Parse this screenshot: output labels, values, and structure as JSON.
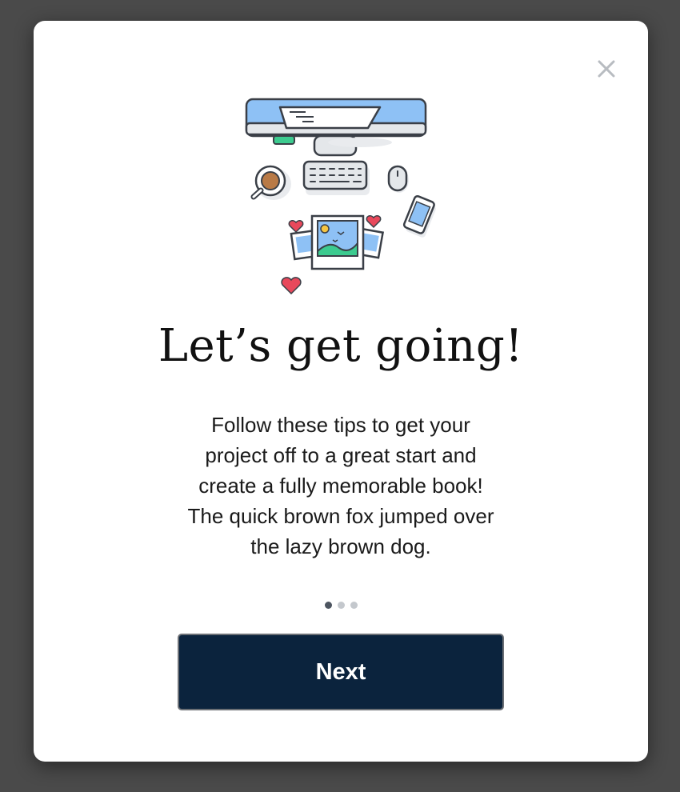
{
  "modal": {
    "title": "Let’s get going!",
    "body": "Follow these tips to get your project off to a great start and create a fully memorable book! The quick brown fox jumped over the lazy brown dog.",
    "next_label": "Next",
    "close_icon": "close-icon",
    "illustration": "desk-workspace-illustration"
  },
  "pagination": {
    "current_step": 1,
    "total_steps": 3
  },
  "colors": {
    "overlay": "#4a4a4a",
    "button_bg": "#0b233d",
    "dot_active": "#4d5560",
    "dot_inactive": "#c4c8cd",
    "accent_blue": "#7ab4f0",
    "accent_green": "#3ccb8f",
    "heart_red": "#e8485b"
  }
}
